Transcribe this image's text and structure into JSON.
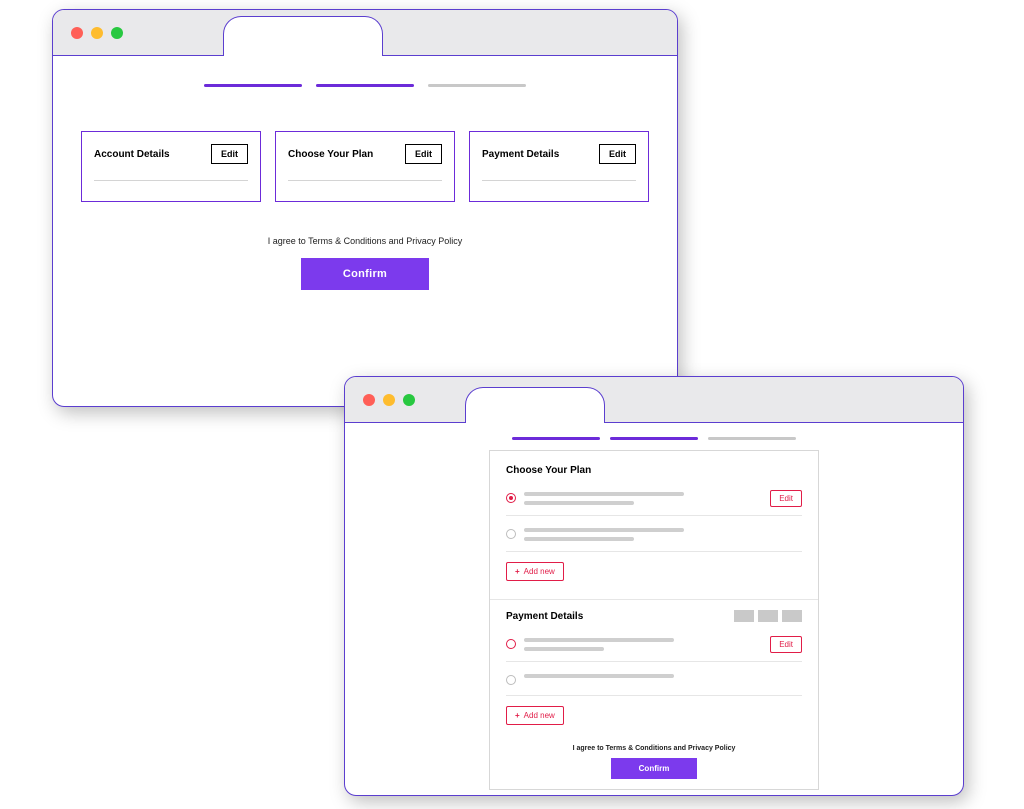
{
  "colors": {
    "accent": "#7c3aed",
    "outline": "#6c2bd9",
    "danger": "#e11d48"
  },
  "progress_steps": 3,
  "window1": {
    "progress": [
      "done",
      "done",
      "pending"
    ],
    "cards": [
      {
        "title": "Account Details",
        "edit_label": "Edit"
      },
      {
        "title": "Choose Your Plan",
        "edit_label": "Edit"
      },
      {
        "title": "Payment Details",
        "edit_label": "Edit"
      }
    ],
    "agree_text": "I agree to Terms & Conditions and Privacy Policy",
    "confirm_label": "Confirm"
  },
  "window2": {
    "progress": [
      "done",
      "done",
      "pending"
    ],
    "plan_section": {
      "title": "Choose Your Plan",
      "edit_label": "Edit",
      "add_label": "Add new"
    },
    "payment_section": {
      "title": "Payment Details",
      "edit_label": "Edit",
      "add_label": "Add new"
    },
    "agree_text": "I agree to Terms & Conditions and Privacy Policy",
    "confirm_label": "Confirm"
  }
}
